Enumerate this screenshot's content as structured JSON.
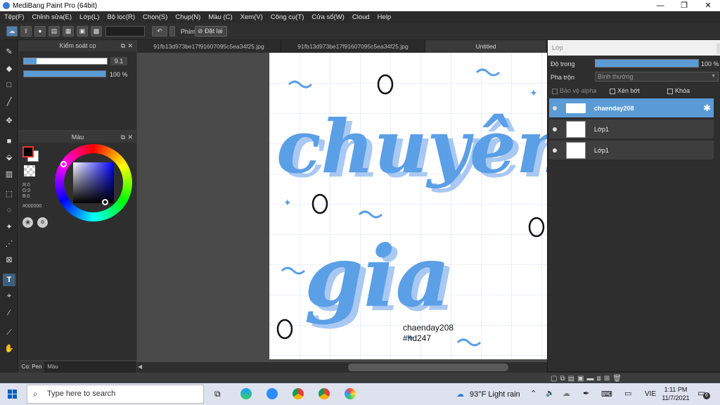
{
  "window": {
    "title": "MediBang Paint Pro (64bit)",
    "minimize": "—",
    "maximize": "❐",
    "close": "✕"
  },
  "menu": [
    "Tệp(F)",
    "Chỉnh sửa(E)",
    "Lớp(L)",
    "Bộ lọc(R)",
    "Chọn(S)",
    "Chụp(N)",
    "Màu (C)",
    "Xem(V)",
    "Công cụ(T)",
    "Cửa sổ(W)",
    "Cloud",
    "Help"
  ],
  "toolbar": {
    "shortcut_label": "Phím",
    "reset_label": "Đặt lại"
  },
  "brush_panel": {
    "title": "Kiểm soát cọ",
    "size_value": "9.1",
    "opacity_value": "100 %",
    "opacity_fill": 1.0
  },
  "color_panel": {
    "title": "Màu",
    "r": "R:0",
    "g": "G:0",
    "b": "B:0",
    "hex": "#000000",
    "color_hex": "#000000"
  },
  "left_tabs": {
    "pen": "Co: Pen",
    "color": "Màu"
  },
  "tabs": [
    "91fb13d973be17f91607095c5ea34f25.jpg",
    "91fb13d973be17f91607095c5ea34f25.jpg",
    "Untitled"
  ],
  "canvas": {
    "line1": "chuyên",
    "line2": "gia",
    "watermark_name": "chaenday208",
    "watermark_tag": "#hd247",
    "accent_color": "#5b9fe6"
  },
  "layer_panel": {
    "title": "Lớp",
    "opacity_label": "Độ trong",
    "opacity_value": "100 %",
    "blend_label": "Pha trộn",
    "blend_value": "Bình thường",
    "protect_alpha": "Bảo vệ alpha",
    "clipping": "Xén bớt",
    "lock": "Khóa",
    "layers": [
      {
        "name": "chaenday208",
        "selected": true
      },
      {
        "name": "Lớp1",
        "selected": false
      },
      {
        "name": "Lớp1",
        "selected": false
      }
    ]
  },
  "taskbar": {
    "search_placeholder": "Type here to search",
    "weather": "93°F  Light rain",
    "lang": "VIE",
    "time": "1:11 PM",
    "date": "11/7/2021",
    "notifications": "6"
  }
}
